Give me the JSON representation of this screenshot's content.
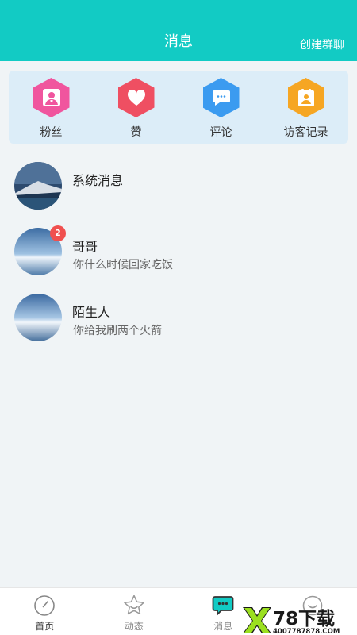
{
  "header": {
    "title": "消息",
    "action": "创建群聊"
  },
  "quick_actions": [
    {
      "label": "粉丝",
      "icon": "fans-icon",
      "color": "#f0559e"
    },
    {
      "label": "赞",
      "icon": "heart-icon",
      "color": "#ef4f62"
    },
    {
      "label": "评论",
      "icon": "comment-icon",
      "color": "#3b9bf0"
    },
    {
      "label": "访客记录",
      "icon": "visitor-icon",
      "color": "#f6a623"
    }
  ],
  "messages": [
    {
      "name": "系统消息",
      "preview": ""
    },
    {
      "name": "哥哥",
      "preview": "你什么时候回家吃饭",
      "badge": "2"
    },
    {
      "name": "陌生人",
      "preview": "你给我刷两个火箭"
    }
  ],
  "tabbar": [
    {
      "label": "首页",
      "icon": "compass-icon"
    },
    {
      "label": "动态",
      "icon": "star-icon"
    },
    {
      "label": "消息",
      "icon": "chat-icon",
      "active": true
    },
    {
      "label": "",
      "icon": "smile-icon"
    }
  ],
  "watermark": {
    "logo_text": "78下载",
    "url_text": "4007787878.COM"
  }
}
